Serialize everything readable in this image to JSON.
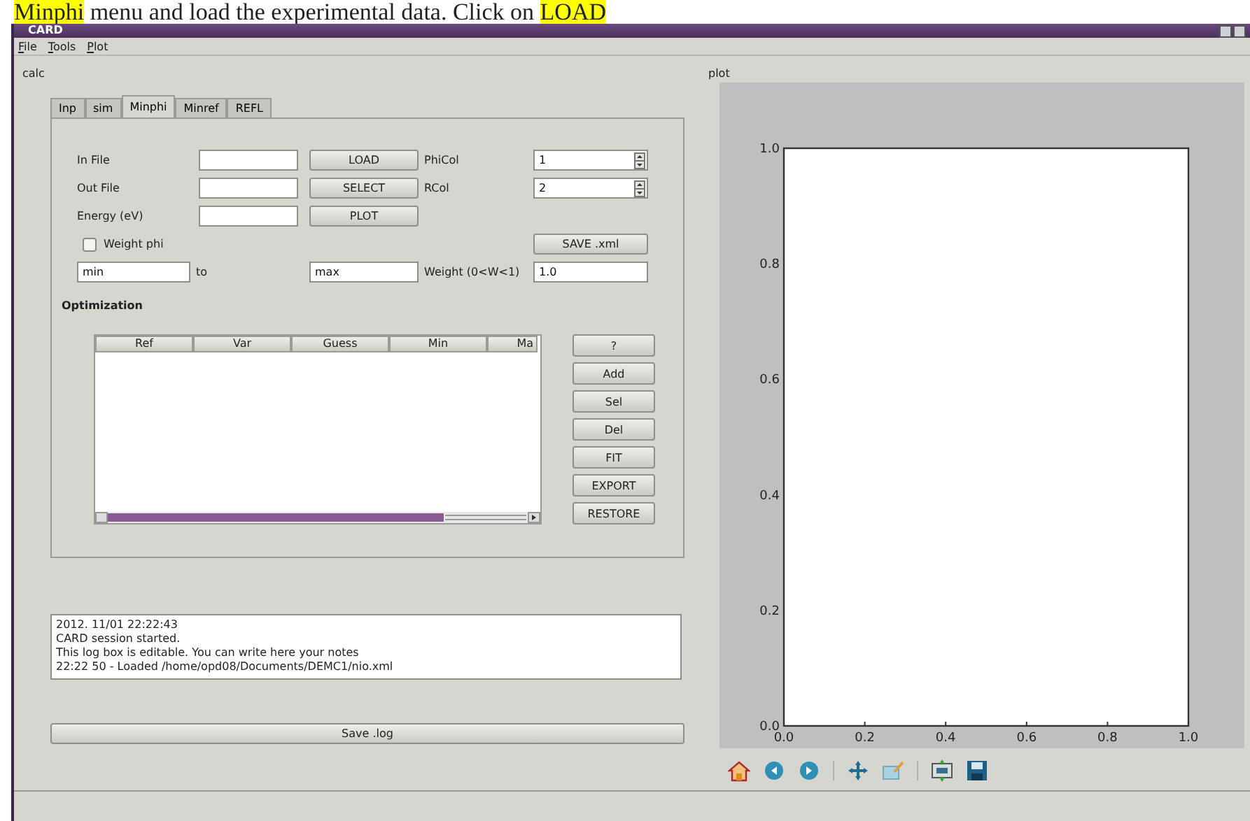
{
  "caption": [
    {
      "text": "Minphi",
      "highlighted": true
    },
    {
      "text": " menu and load the experimental data. Click on ",
      "highlighted": false
    },
    {
      "text": "LOAD",
      "highlighted": true
    }
  ],
  "window": {
    "title": "CARD"
  },
  "menu": [
    "File",
    "Tools",
    "Plot"
  ],
  "calc": {
    "label": "calc",
    "tabs": [
      {
        "label": "Inp",
        "selected": false
      },
      {
        "label": "sim",
        "selected": false
      },
      {
        "label": "Minphi",
        "selected": true
      },
      {
        "label": "Minref",
        "selected": false
      },
      {
        "label": "REFL",
        "selected": false
      }
    ],
    "rows": [
      {
        "label": "In File",
        "button": "LOAD",
        "side_label": "PhiCol",
        "spin_value": "1"
      },
      {
        "label": "Out File",
        "button": "SELECT",
        "side_label": "RCol",
        "spin_value": "2"
      },
      {
        "label": "Energy (eV)",
        "button": "PLOT"
      }
    ],
    "weight_phi": {
      "label": "Weight phi",
      "checked": false
    },
    "save_xml": "SAVE .xml",
    "range": {
      "min": "min",
      "to": "to",
      "max": "max",
      "weight_label": "Weight (0<W<1)",
      "weight_value": "1.0"
    },
    "optimization": {
      "title": "Optimization",
      "columns": [
        "Ref",
        "Var",
        "Guess",
        "Min",
        "Ma"
      ],
      "buttons": [
        "?",
        "Add",
        "Sel",
        "Del",
        "FIT",
        "EXPORT",
        "RESTORE"
      ]
    },
    "log": [
      "2012. 11/01 22:22:43",
      "CARD session started.",
      "This log box is editable. You can write here your notes",
      "22:22 50 - Loaded /home/opd08/Documents/DEMC1/nio.xml"
    ],
    "save_log": "Save .log"
  },
  "plot": {
    "label": "plot",
    "chart_data": {
      "type": "line",
      "xlim": [
        0,
        1
      ],
      "ylim": [
        0,
        1
      ],
      "xticks": [
        {
          "value": 0,
          "label": "0.0"
        },
        {
          "value": 0.2,
          "label": "0.2"
        },
        {
          "value": 0.4,
          "label": "0.4"
        },
        {
          "value": 0.6,
          "label": "0.6"
        },
        {
          "value": 0.8,
          "label": "0.8"
        },
        {
          "value": 1,
          "label": "1.0"
        }
      ],
      "yticks": [
        {
          "value": 0,
          "label": "0.0"
        },
        {
          "value": 0.2,
          "label": "0.2"
        },
        {
          "value": 0.4,
          "label": "0.4"
        },
        {
          "value": 0.6,
          "label": "0.6"
        },
        {
          "value": 0.8,
          "label": "0.8"
        },
        {
          "value": 1,
          "label": "1.0"
        }
      ]
    }
  }
}
